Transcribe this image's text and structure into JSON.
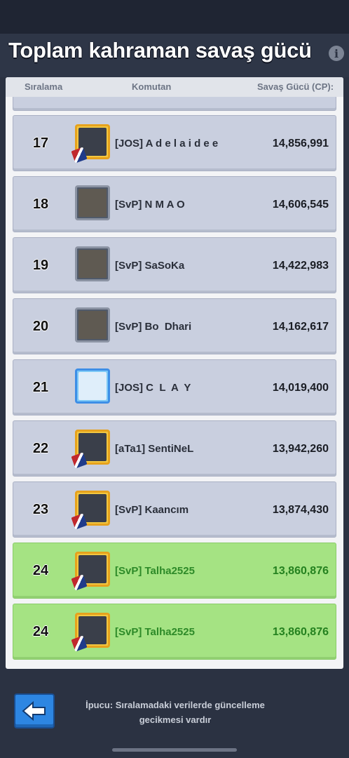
{
  "title": "Toplam kahraman savaş gücü",
  "columns": {
    "rank": "Sıralama",
    "commander": "Komutan",
    "power": "Savaş Gücü (CP):"
  },
  "rows": [
    {
      "rank": "17",
      "name": "[JOS] A d e l a i d e e",
      "power": "14,856,991",
      "frame": "gold",
      "highlight": false
    },
    {
      "rank": "18",
      "name": "[SvP] N M A O",
      "power": "14,606,545",
      "frame": "silver",
      "highlight": false
    },
    {
      "rank": "19",
      "name": "[SvP] SaSoKa",
      "power": "14,422,983",
      "frame": "silver",
      "highlight": false
    },
    {
      "rank": "20",
      "name": "[SvP] Bo  Dhari",
      "power": "14,162,617",
      "frame": "silver",
      "highlight": false
    },
    {
      "rank": "21",
      "name": "[JOS] C  L  A  Y",
      "power": "14,019,400",
      "frame": "blue",
      "highlight": false
    },
    {
      "rank": "22",
      "name": "[aTa1] SentiNeL",
      "power": "13,942,260",
      "frame": "gold",
      "highlight": false
    },
    {
      "rank": "23",
      "name": "[SvP] Kaancım",
      "power": "13,874,430",
      "frame": "gold",
      "highlight": false
    },
    {
      "rank": "24",
      "name": "[SvP] Talha2525",
      "power": "13,860,876",
      "frame": "gold",
      "highlight": true
    },
    {
      "rank": "24",
      "name": "[SvP] Talha2525",
      "power": "13,860,876",
      "frame": "gold",
      "highlight": true
    }
  ],
  "hint": "İpucu: Sıralamadaki verilerde güncelleme gecikmesi vardır",
  "icons": {
    "info": "info-icon",
    "back": "back-arrow-icon"
  },
  "colors": {
    "highlight": "#a5e383",
    "row": "#c9cfdf",
    "accent": "#2d86e2"
  }
}
